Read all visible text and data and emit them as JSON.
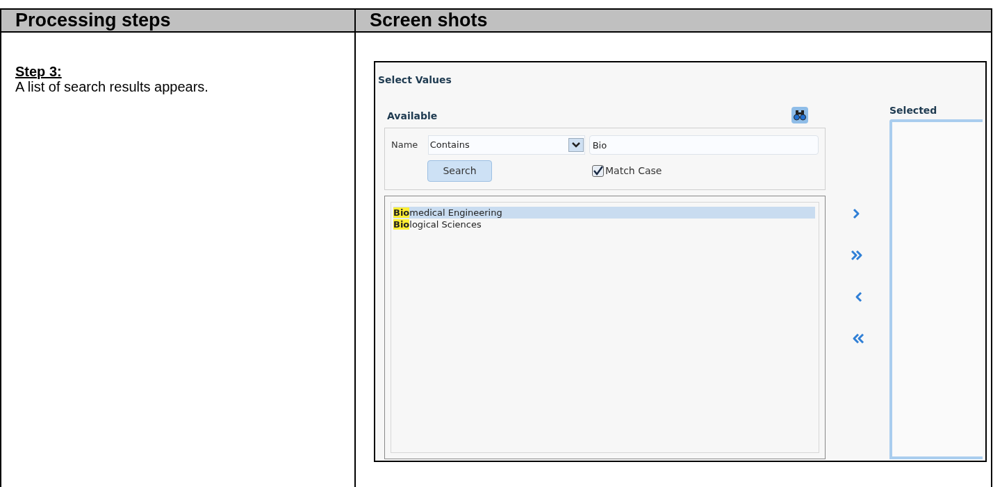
{
  "table": {
    "columns": [
      "Processing steps",
      "Screen shots"
    ],
    "step": {
      "title": "Step 3:",
      "text": "A list of search results appears."
    }
  },
  "screenshot": {
    "title": "Select Values",
    "available_label": "Available",
    "selected_label": "Selected",
    "filter": {
      "label": "Name",
      "operator": "Contains",
      "value": "Bio",
      "search_button": "Search",
      "match_case": {
        "label": "Match Case",
        "checked": true
      }
    },
    "results": [
      {
        "match": "Bio",
        "rest": "medical Engineering",
        "selected": true
      },
      {
        "match": "Bio",
        "rest": "logical Sciences",
        "selected": false
      }
    ]
  }
}
